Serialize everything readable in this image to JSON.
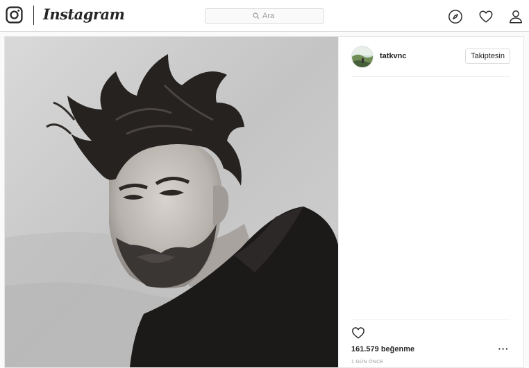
{
  "brand": {
    "name": "Instagram"
  },
  "search": {
    "placeholder": "Ara"
  },
  "nav": {
    "icons": [
      "compass-icon",
      "heart-icon",
      "user-icon"
    ]
  },
  "post": {
    "username": "tatkvnc",
    "follow_label": "Takiptesin",
    "likes": "161.579 beğenme",
    "time": "1 GÜN ÖNCE",
    "more": "···"
  },
  "colors": {
    "border": "#dbdbdb",
    "text": "#262626",
    "muted": "#999999",
    "background": "#fafafa"
  }
}
